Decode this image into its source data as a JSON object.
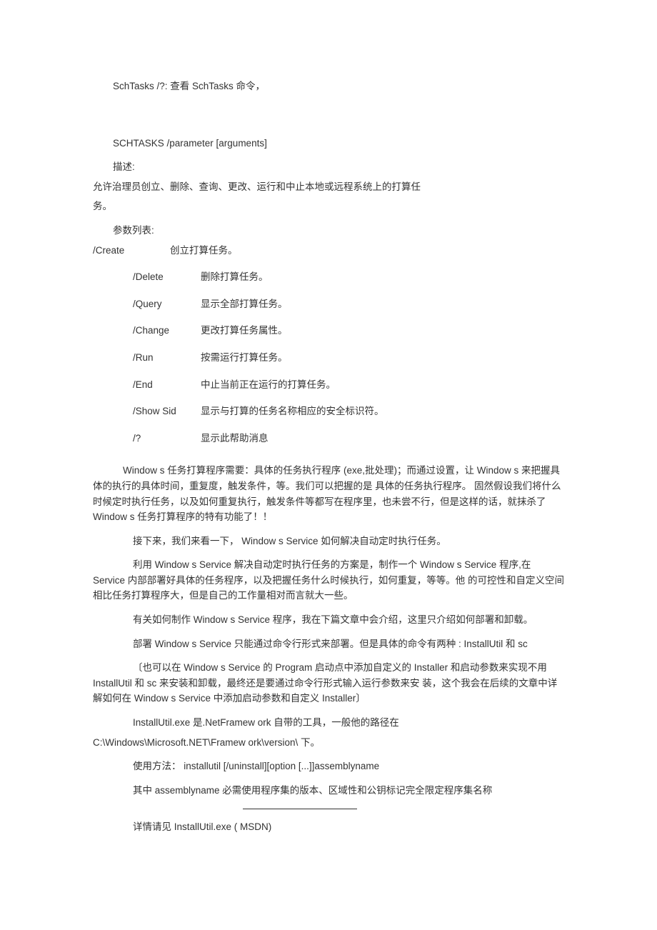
{
  "top": {
    "line1": "SchTasks /?:    查看  SchTasks 命令，"
  },
  "usage": {
    "cmd": "SCHTASKS /parameter [arguments]",
    "descLabel": "描述:",
    "descBody1": "允许治理员创立、删除、查询、更改、运行和中止本地或远程系统上的打算任",
    "descBody2": "务。",
    "paramLabel": "参数列表:"
  },
  "params": [
    {
      "cmd": "/Create",
      "desc": "创立打算任务。"
    },
    {
      "cmd": "/Delete",
      "desc": "删除打算任务。"
    },
    {
      "cmd": "/Query",
      "desc": "显示全部打算任务。"
    },
    {
      "cmd": "/Change",
      "desc": "更改打算任务属性。"
    },
    {
      "cmd": "/Run",
      "desc": "按需运行打算任务。"
    },
    {
      "cmd": "/End",
      "desc": "中止当前正在运行的打算任务。"
    },
    {
      "cmd": "/Show Sid",
      "desc": "显示与打算的任务名称相应的安全标识符。"
    },
    {
      "cmd": "/?",
      "desc": "显示此帮助消息"
    }
  ],
  "body": {
    "p1": "Window s 任务打算程序需要：具体的任务执行程序 (exe,批处理)；而通过设置，让 Window s 来把握具体的执行的具体时间，重复度，触发条件，等。我们可以把握的是      具体的任务执行程序。  固然假设我们将什么时候定时执行任务，以及如何重复执行，触发条件等都写在程序里，也未尝不行，但是这样的话，就抹杀了   Window s 任务打算程序的特有功能了！！",
    "p2": "接下来，我们来看一下，  Window s Service   如何解决自动定时执行任务。",
    "p3": "利用  Window s Service 解决自动定时执行任务的方案是，制作一个  Window s Service 程序,在 Service 内部部署好具体的任务程序，以及把握任务什么时候执行，如何重复，等等。他     的可控性和自定义空间相比任务打算程序大，但是自己的工作量相对而言就大一些。",
    "p4": "有关如何制作  Window s  Service  程序，我在下篇文章中会介绍，这里只介绍如何部署和卸载。",
    "p5": "部署 Window s Service 只能通过命令行形式来部署。但是具体的命令有两种 : InstallUtil 和  sc",
    "p6": "〔也可以在  Window s Service 的 Program 启动点中添加自定义的  Installer 和启动参数来实现不用 InstallUtil  和  sc 来安装和卸载，最终还是要通过命令行形式输入运行参数来安  装，这个我会在后续的文章中详解如何在  Window s Service 中添加启动参数和自定义  Installer〕",
    "p7a": "InstallUtil.exe 是.NetFramew ork 自带的工具，一般他的路径在",
    "p7b": "C:\\Windows\\Microsoft.NET\\Framew ork\\version\\  下。",
    "p8": "使用方法：  installutil [/uninstall][option [...]]assemblyname",
    "p9": "其中  assemblyname 必需使用程序集的版本、区域性和公钥标记完全限定程序集名称",
    "p10": "详情请见  InstallUtil.exe ( MSDN)"
  }
}
